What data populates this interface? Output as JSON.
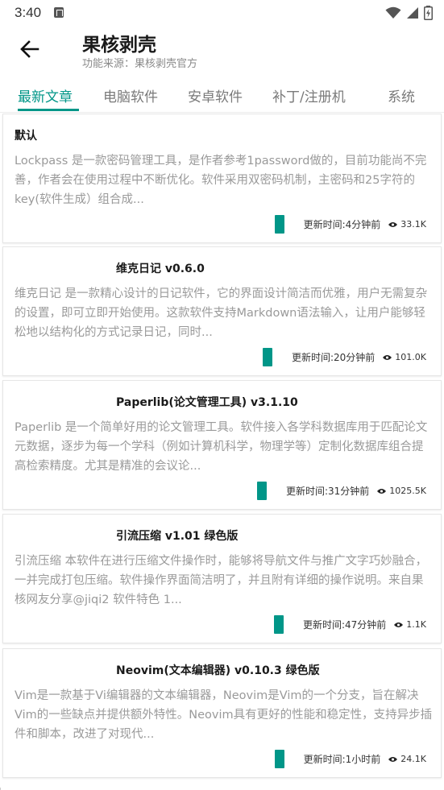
{
  "status_bar": {
    "time": "3:40"
  },
  "app_bar": {
    "title": "果核剥壳",
    "subtitle": "功能来源：果核剥壳官方"
  },
  "tabs": [
    {
      "label": "最新文章",
      "active": true
    },
    {
      "label": "电脑软件",
      "active": false
    },
    {
      "label": "安卓软件",
      "active": false
    },
    {
      "label": "补丁/注册机",
      "active": false
    },
    {
      "label": "系统",
      "active": false
    }
  ],
  "articles": [
    {
      "title": "默认",
      "description": "Lockpass 是一款密码管理工具，是作者参考1password做的，目前功能尚不完善，作者会在使用过程中不断优化。软件采用双密码机制，主密码和25字符的key(软件生成）组合成...",
      "time": "更新时间:4分钟前",
      "views": "33.1K"
    },
    {
      "title": "维克日记 v0.6.0",
      "description": "维克日记 是一款精心设计的日记软件，它的界面设计简洁而优雅，用户无需复杂的设置，即可立即开始使用。这款软件支持Markdown语法输入，让用户能够轻松地以结构化的方式记录日记，同时...",
      "time": "更新时间:20分钟前",
      "views": "101.0K"
    },
    {
      "title": "Paperlib(论文管理工具) v3.1.10",
      "description": "Paperlib 是一个简单好用的论文管理工具。软件接入各学科数据库用于匹配论文元数据，逐步为每一个学科（例如计算机科学，物理学等）定制化数据库组合提高检索精度。尤其是精准的会议论...",
      "time": "更新时间:31分钟前",
      "views": "1025.5K"
    },
    {
      "title": "引流压缩 v1.01 绿色版",
      "description": "引流压缩 本软件在进行压缩文件操作时，能够将导航文件与推广文字巧妙融合，一并完成打包压缩。软件操作界面简洁明了，并且附有详细的操作说明。来自果核网友分享@jiqi2 软件特色 1...",
      "time": "更新时间:47分钟前",
      "views": "1.1K"
    },
    {
      "title": "Neovim(文本编辑器) v0.10.3 绿色版",
      "description": "Vim是一款基于Vi编辑器的文本编辑器，Neovim是Vim的一个分支，旨在解决Vim的一些缺点并提供额外特性。Neovim具有更好的性能和稳定性，支持异步插件和脚本，改进了对现代...",
      "time": "更新时间:1小时前",
      "views": "24.1K"
    }
  ],
  "colors": {
    "accent": "#009688",
    "description_text": "#9a9a9a",
    "inactive_tab": "#7a7a7a"
  }
}
